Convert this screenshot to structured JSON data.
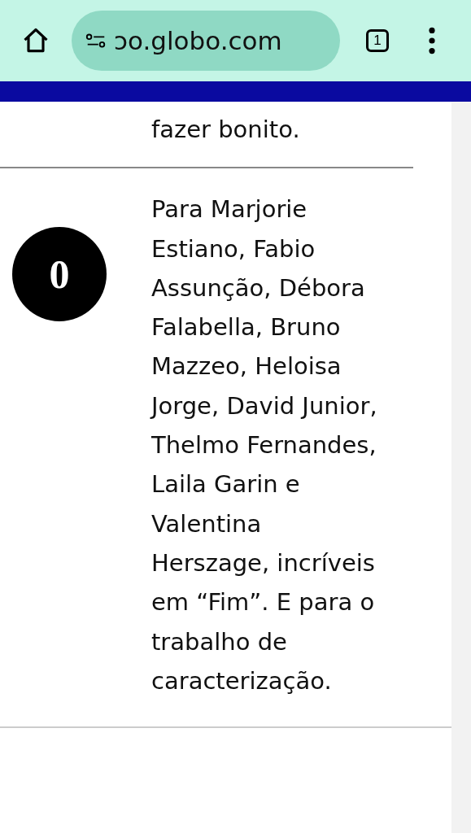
{
  "browser": {
    "url": "ɔo.globo.com",
    "tab_count": "1"
  },
  "items": [
    {
      "text": "fazer bonito."
    },
    {
      "badge": "0",
      "text": "Para Marjorie Estiano, Fabio Assunção, Débora Falabella, Bruno Mazzeo, Heloisa Jorge, David Junior, Thelmo Fernandes, Laila Garin e Valentina Herszage, incríveis em “Fim”. E para o trabalho de caracterização."
    }
  ]
}
